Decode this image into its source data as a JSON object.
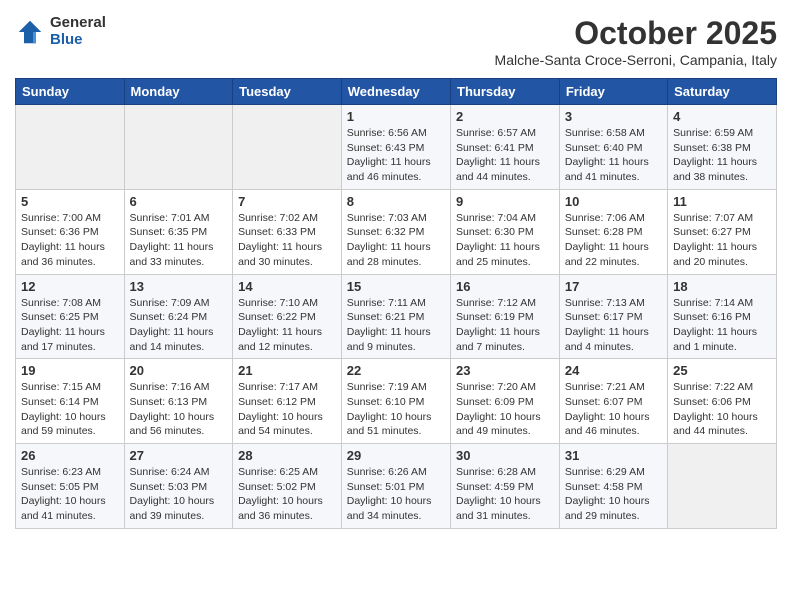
{
  "header": {
    "logo_general": "General",
    "logo_blue": "Blue",
    "month_title": "October 2025",
    "location": "Malche-Santa Croce-Serroni, Campania, Italy"
  },
  "days_of_week": [
    "Sunday",
    "Monday",
    "Tuesday",
    "Wednesday",
    "Thursday",
    "Friday",
    "Saturday"
  ],
  "weeks": [
    [
      {
        "day": "",
        "info": ""
      },
      {
        "day": "",
        "info": ""
      },
      {
        "day": "",
        "info": ""
      },
      {
        "day": "1",
        "info": "Sunrise: 6:56 AM\nSunset: 6:43 PM\nDaylight: 11 hours\nand 46 minutes."
      },
      {
        "day": "2",
        "info": "Sunrise: 6:57 AM\nSunset: 6:41 PM\nDaylight: 11 hours\nand 44 minutes."
      },
      {
        "day": "3",
        "info": "Sunrise: 6:58 AM\nSunset: 6:40 PM\nDaylight: 11 hours\nand 41 minutes."
      },
      {
        "day": "4",
        "info": "Sunrise: 6:59 AM\nSunset: 6:38 PM\nDaylight: 11 hours\nand 38 minutes."
      }
    ],
    [
      {
        "day": "5",
        "info": "Sunrise: 7:00 AM\nSunset: 6:36 PM\nDaylight: 11 hours\nand 36 minutes."
      },
      {
        "day": "6",
        "info": "Sunrise: 7:01 AM\nSunset: 6:35 PM\nDaylight: 11 hours\nand 33 minutes."
      },
      {
        "day": "7",
        "info": "Sunrise: 7:02 AM\nSunset: 6:33 PM\nDaylight: 11 hours\nand 30 minutes."
      },
      {
        "day": "8",
        "info": "Sunrise: 7:03 AM\nSunset: 6:32 PM\nDaylight: 11 hours\nand 28 minutes."
      },
      {
        "day": "9",
        "info": "Sunrise: 7:04 AM\nSunset: 6:30 PM\nDaylight: 11 hours\nand 25 minutes."
      },
      {
        "day": "10",
        "info": "Sunrise: 7:06 AM\nSunset: 6:28 PM\nDaylight: 11 hours\nand 22 minutes."
      },
      {
        "day": "11",
        "info": "Sunrise: 7:07 AM\nSunset: 6:27 PM\nDaylight: 11 hours\nand 20 minutes."
      }
    ],
    [
      {
        "day": "12",
        "info": "Sunrise: 7:08 AM\nSunset: 6:25 PM\nDaylight: 11 hours\nand 17 minutes."
      },
      {
        "day": "13",
        "info": "Sunrise: 7:09 AM\nSunset: 6:24 PM\nDaylight: 11 hours\nand 14 minutes."
      },
      {
        "day": "14",
        "info": "Sunrise: 7:10 AM\nSunset: 6:22 PM\nDaylight: 11 hours\nand 12 minutes."
      },
      {
        "day": "15",
        "info": "Sunrise: 7:11 AM\nSunset: 6:21 PM\nDaylight: 11 hours\nand 9 minutes."
      },
      {
        "day": "16",
        "info": "Sunrise: 7:12 AM\nSunset: 6:19 PM\nDaylight: 11 hours\nand 7 minutes."
      },
      {
        "day": "17",
        "info": "Sunrise: 7:13 AM\nSunset: 6:17 PM\nDaylight: 11 hours\nand 4 minutes."
      },
      {
        "day": "18",
        "info": "Sunrise: 7:14 AM\nSunset: 6:16 PM\nDaylight: 11 hours\nand 1 minute."
      }
    ],
    [
      {
        "day": "19",
        "info": "Sunrise: 7:15 AM\nSunset: 6:14 PM\nDaylight: 10 hours\nand 59 minutes."
      },
      {
        "day": "20",
        "info": "Sunrise: 7:16 AM\nSunset: 6:13 PM\nDaylight: 10 hours\nand 56 minutes."
      },
      {
        "day": "21",
        "info": "Sunrise: 7:17 AM\nSunset: 6:12 PM\nDaylight: 10 hours\nand 54 minutes."
      },
      {
        "day": "22",
        "info": "Sunrise: 7:19 AM\nSunset: 6:10 PM\nDaylight: 10 hours\nand 51 minutes."
      },
      {
        "day": "23",
        "info": "Sunrise: 7:20 AM\nSunset: 6:09 PM\nDaylight: 10 hours\nand 49 minutes."
      },
      {
        "day": "24",
        "info": "Sunrise: 7:21 AM\nSunset: 6:07 PM\nDaylight: 10 hours\nand 46 minutes."
      },
      {
        "day": "25",
        "info": "Sunrise: 7:22 AM\nSunset: 6:06 PM\nDaylight: 10 hours\nand 44 minutes."
      }
    ],
    [
      {
        "day": "26",
        "info": "Sunrise: 6:23 AM\nSunset: 5:05 PM\nDaylight: 10 hours\nand 41 minutes."
      },
      {
        "day": "27",
        "info": "Sunrise: 6:24 AM\nSunset: 5:03 PM\nDaylight: 10 hours\nand 39 minutes."
      },
      {
        "day": "28",
        "info": "Sunrise: 6:25 AM\nSunset: 5:02 PM\nDaylight: 10 hours\nand 36 minutes."
      },
      {
        "day": "29",
        "info": "Sunrise: 6:26 AM\nSunset: 5:01 PM\nDaylight: 10 hours\nand 34 minutes."
      },
      {
        "day": "30",
        "info": "Sunrise: 6:28 AM\nSunset: 4:59 PM\nDaylight: 10 hours\nand 31 minutes."
      },
      {
        "day": "31",
        "info": "Sunrise: 6:29 AM\nSunset: 4:58 PM\nDaylight: 10 hours\nand 29 minutes."
      },
      {
        "day": "",
        "info": ""
      }
    ]
  ]
}
